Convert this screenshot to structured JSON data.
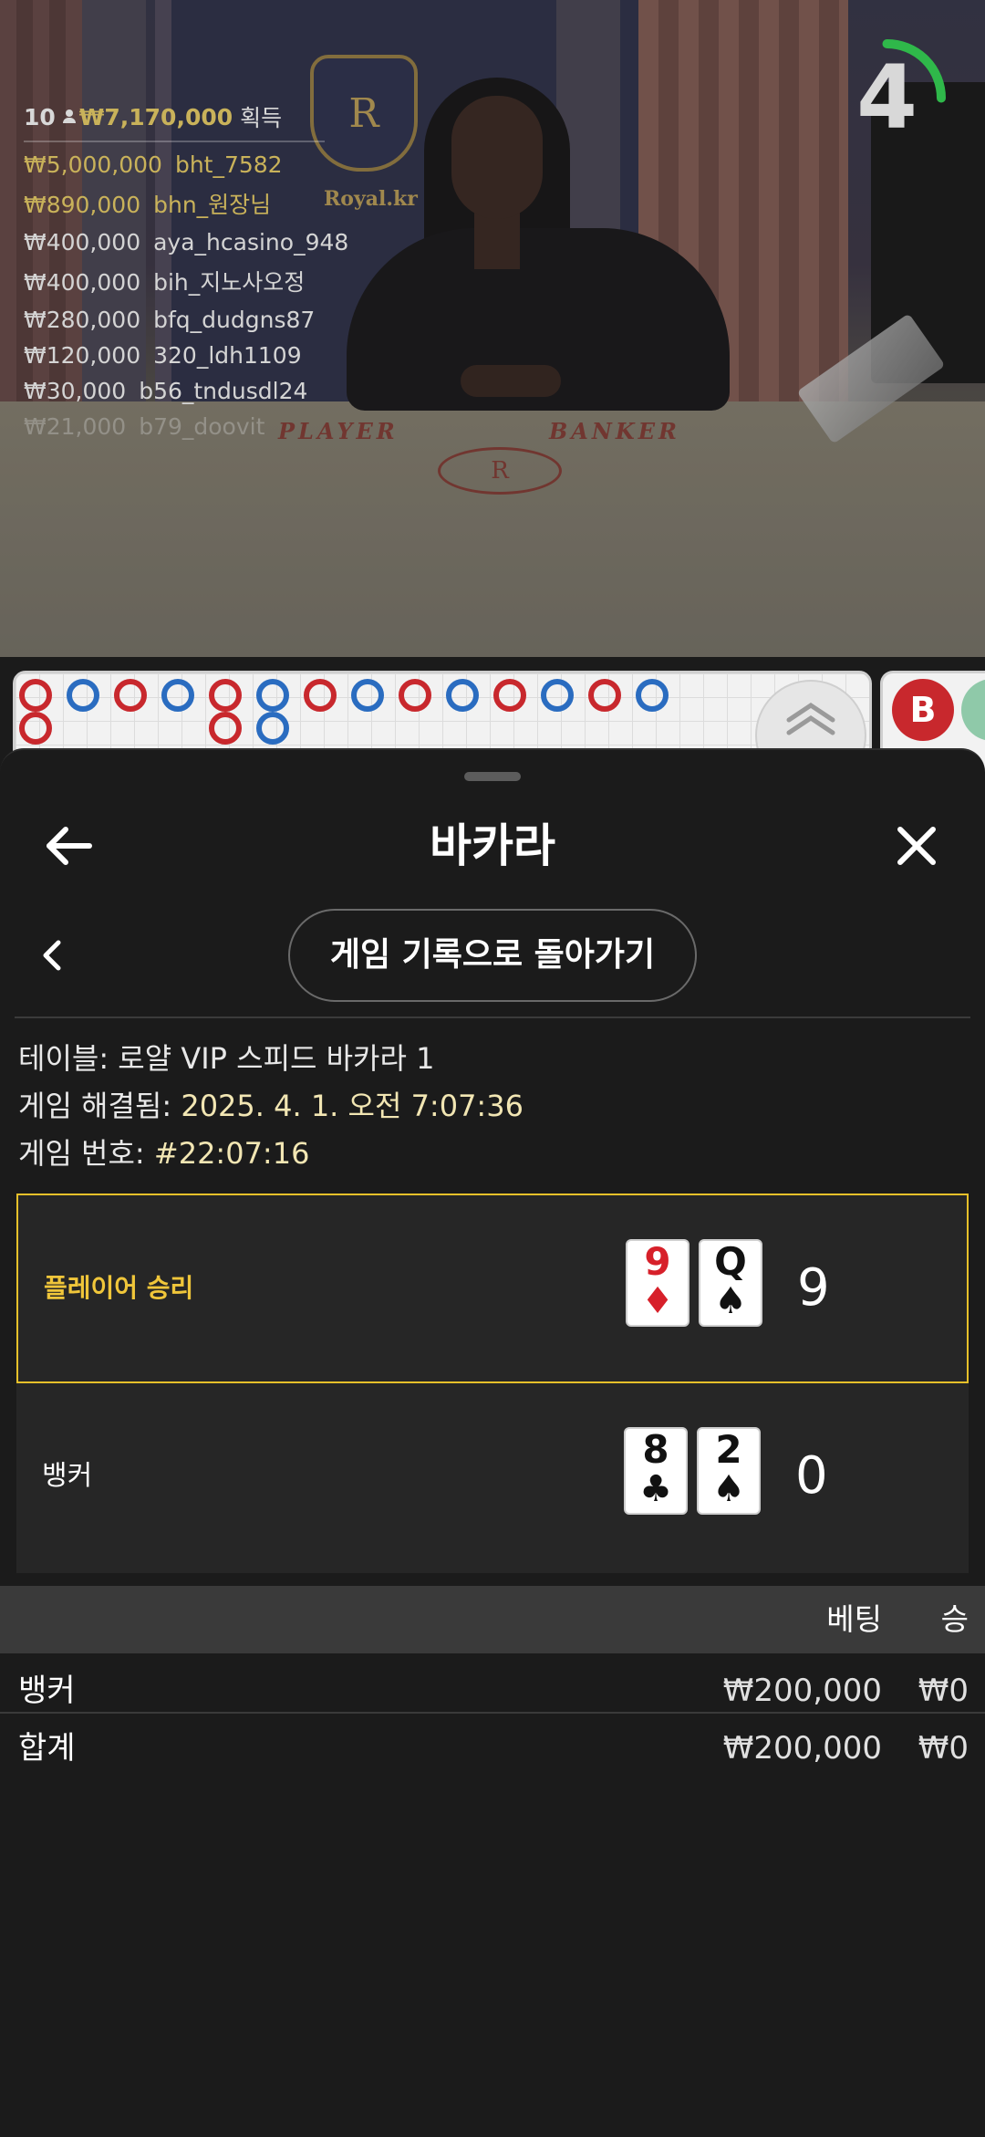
{
  "video": {
    "table_sign": "Royal.kr",
    "crest_letter": "R",
    "felt_player": "PLAYER",
    "felt_banker": "BANKER",
    "timer": "4",
    "timer_color": "#2fb84a"
  },
  "winners": {
    "count": "10",
    "total": "₩7,170,000",
    "gain_label": "획득",
    "rows": [
      {
        "amount": "₩5,000,000",
        "name": "bht_7582",
        "highlight": true
      },
      {
        "amount": "₩890,000",
        "name": "bhn_원장님",
        "highlight": true
      },
      {
        "amount": "₩400,000",
        "name": "aya_hcasino_948",
        "highlight": false
      },
      {
        "amount": "₩400,000",
        "name": "bih_지노사오정",
        "highlight": false
      },
      {
        "amount": "₩280,000",
        "name": "bfq_dudgns87",
        "highlight": false
      },
      {
        "amount": "₩120,000",
        "name": "320_ldh1109",
        "highlight": false
      },
      {
        "amount": "₩30,000",
        "name": "b56_tndusdl24",
        "highlight": false
      },
      {
        "amount": "₩21,000",
        "name": "b79_doovit",
        "highlight": false
      }
    ]
  },
  "road": {
    "top_row": [
      "B",
      "P",
      "B",
      "P",
      "B",
      "P",
      "B",
      "P",
      "B",
      "P",
      "B",
      "P",
      "B",
      "P"
    ],
    "bottom_row": [
      "B",
      "",
      "",
      "",
      "B",
      "P",
      "",
      "",
      "",
      "",
      "",
      "",
      "",
      ""
    ],
    "side_badge": "B",
    "colors": {
      "player": "#2a6cc0",
      "banker": "#c8282d"
    }
  },
  "sheet": {
    "title": "바카라",
    "history_button": "게임 기록으로 돌아가기",
    "meta": {
      "table_label": "테이블:",
      "table_value": "로얄 VIP 스피드 바카라 1",
      "resolved_label": "게임 해결됨:",
      "resolved_value": "2025. 4. 1. 오전 7:07:36",
      "number_label": "게임 번호:",
      "number_value": "#22:07:16"
    },
    "player": {
      "label": "플레이어 승리",
      "cards": [
        {
          "rank": "9",
          "suit": "♦",
          "color": "red"
        },
        {
          "rank": "Q",
          "suit": "♠",
          "color": "black"
        }
      ],
      "score": "9"
    },
    "banker": {
      "label": "뱅커",
      "cards": [
        {
          "rank": "8",
          "suit": "♣",
          "color": "black"
        },
        {
          "rank": "2",
          "suit": "♠",
          "color": "black"
        }
      ],
      "score": "0"
    },
    "bets": {
      "header_bet": "베팅",
      "header_win": "승",
      "rows": [
        {
          "name": "뱅커",
          "bet": "₩200,000",
          "win": "₩0"
        },
        {
          "name": "합계",
          "bet": "₩200,000",
          "win": "₩0"
        }
      ]
    },
    "accent_color": "#e6c02a"
  }
}
